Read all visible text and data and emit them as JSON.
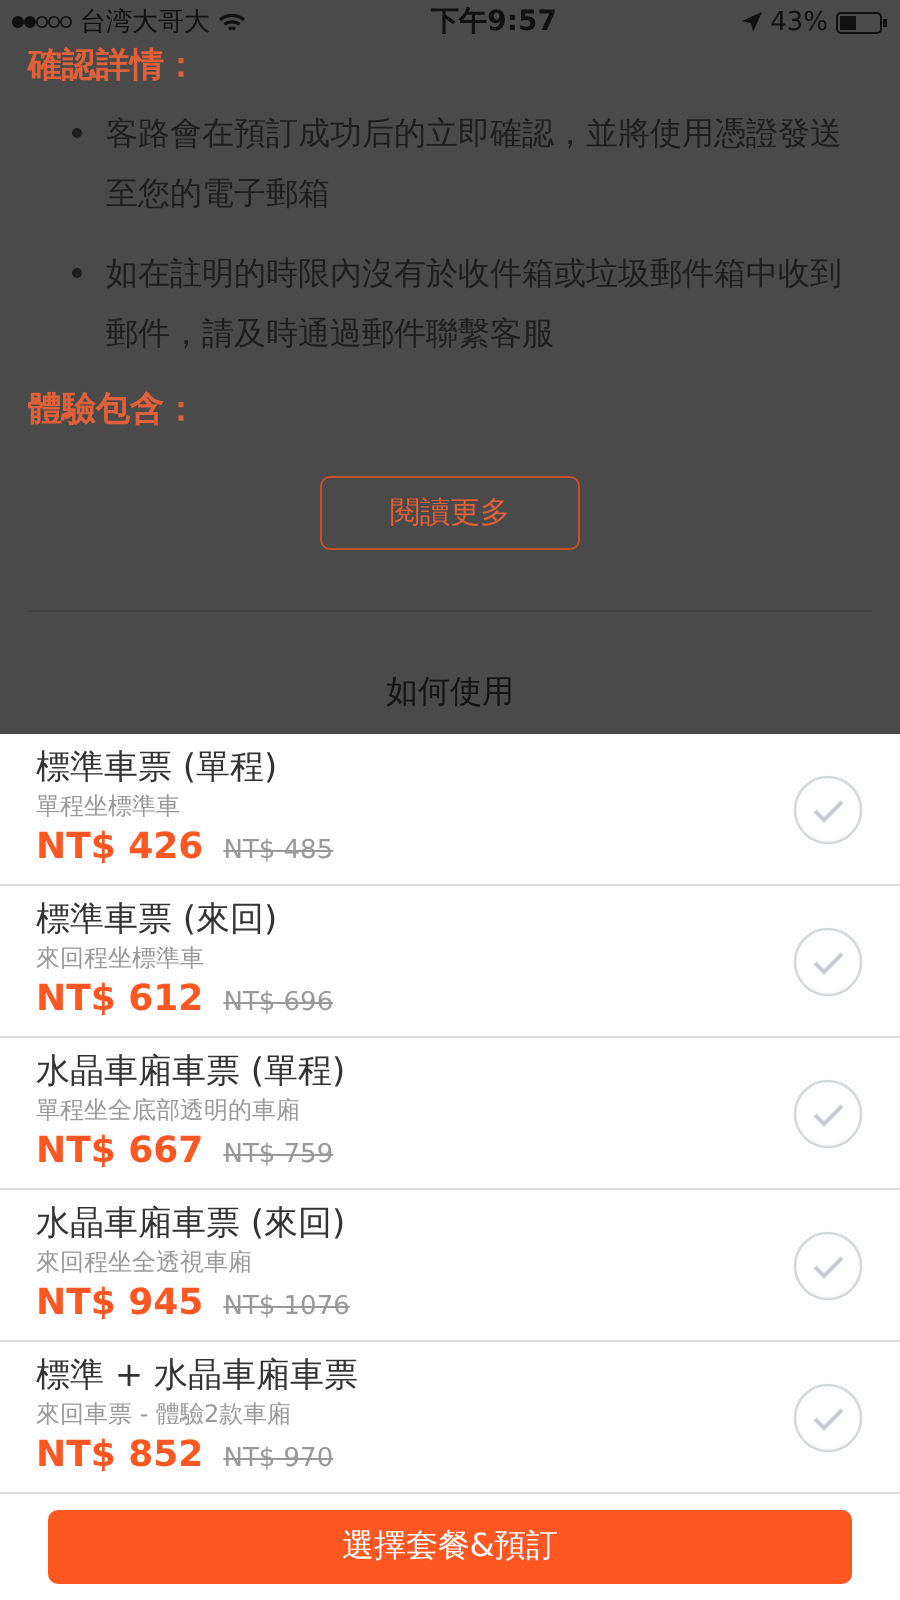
{
  "status_bar": {
    "carrier": "台湾大哥大",
    "time": "下午9:57",
    "battery": "43%"
  },
  "details": {
    "confirm_heading": "確認詳情：",
    "bullets": [
      "客路會在預訂成功后的立即確認，並將使用憑證發送至您的電子郵箱",
      "如在註明的時限內沒有於收件箱或垃圾郵件箱中收到郵件，請及時通過郵件聯繫客服"
    ],
    "includes_heading": "體驗包含：",
    "read_more": "閱讀更多",
    "how_to_use": "如何使用"
  },
  "options": [
    {
      "title": "標準車票 (單程)",
      "subtitle": "單程坐標準車",
      "price": "NT$ 426",
      "original_price": "NT$ 485",
      "selected": false
    },
    {
      "title": "標準車票 (來回)",
      "subtitle": "來回程坐標準車",
      "price": "NT$ 612",
      "original_price": "NT$ 696",
      "selected": false
    },
    {
      "title": "水晶車廂車票 (單程)",
      "subtitle": "單程坐全底部透明的車廂",
      "price": "NT$ 667",
      "original_price": "NT$ 759",
      "selected": false
    },
    {
      "title": "水晶車廂車票 (來回)",
      "subtitle": "來回程坐全透視車廂",
      "price": "NT$ 945",
      "original_price": "NT$ 1076",
      "selected": false
    },
    {
      "title": "標準 + 水晶車廂車票",
      "subtitle": "來回車票 - 體驗2款車廂",
      "price": "NT$ 852",
      "original_price": "NT$ 970",
      "selected": false
    }
  ],
  "book_button": "選擇套餐&預訂"
}
